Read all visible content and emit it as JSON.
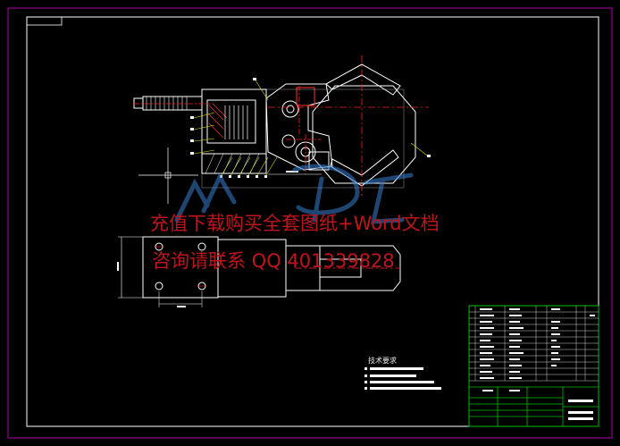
{
  "watermark": {
    "line1": "充值下载购买全套图纸+Word文档",
    "line2": "咨询请联系  QQ 401339828"
  },
  "tech_requirements": {
    "title": "技术要求"
  },
  "colors": {
    "background": "#000000",
    "border": "#b000b0",
    "geometry_white": "#ffffff",
    "centerline_red": "#ff2020",
    "leader_yellow": "#e0e000",
    "title_block_green": "#00c000",
    "watermark_red": "#c0141c",
    "logo_blue": "#3a7fd0"
  },
  "icons": {
    "logo": "watermark-logo-icon"
  }
}
